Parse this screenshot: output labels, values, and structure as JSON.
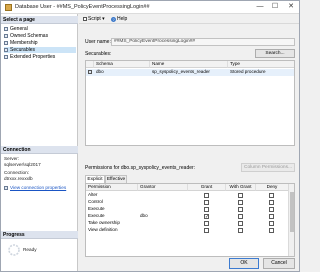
{
  "title": "Database User - ##MS_PolicyEventProcessingLogin##",
  "window_controls": [
    "—",
    "☐",
    "✕"
  ],
  "left": {
    "select_page_header": "Select a page",
    "pages": [
      "General",
      "Owned Schemas",
      "Membership",
      "Securables",
      "Extended Properties"
    ],
    "selected_page": "Securables",
    "connection_header": "Connection",
    "server_label": "Server:",
    "server_value": "sqlserver\\sql2017",
    "connection_label": "Connection:",
    "connection_value": "dtrxxx.rexxxlb",
    "view_connection_link": "View connection properties",
    "progress_header": "Progress",
    "progress_status": "Ready"
  },
  "toolbar": {
    "script": "Script",
    "help": "Help"
  },
  "user_name_label": "User name:",
  "user_name_value": "##MS_PolicyEventProcessingLogin##",
  "search_button": "Search...",
  "securables_label": "Securables:",
  "securables": {
    "headers": [
      "Schema",
      "Name",
      "Type"
    ],
    "rows": [
      {
        "schema": "dbo",
        "name": "sp_syspolicy_events_reader",
        "type": "Stored procedure"
      }
    ]
  },
  "permissions_label": "Permissions for dbo.sp_syspolicy_events_reader:",
  "column_permissions_button": "Column Permissions...",
  "tabs": [
    "Explicit",
    "Effective"
  ],
  "permissions": {
    "headers": [
      "Permission",
      "Grantor",
      "Grant",
      "With Grant",
      "Deny"
    ],
    "rows": [
      {
        "permission": "Alter",
        "grantor": "",
        "grant": false,
        "with_grant": false,
        "deny": false
      },
      {
        "permission": "Control",
        "grantor": "",
        "grant": false,
        "with_grant": false,
        "deny": false
      },
      {
        "permission": "Execute",
        "grantor": "",
        "grant": false,
        "with_grant": false,
        "deny": false
      },
      {
        "permission": "Execute",
        "grantor": "dbo",
        "grant": true,
        "with_grant": false,
        "deny": false
      },
      {
        "permission": "Take ownership",
        "grantor": "",
        "grant": false,
        "with_grant": false,
        "deny": false
      },
      {
        "permission": "View definition",
        "grantor": "",
        "grant": false,
        "with_grant": false,
        "deny": false
      }
    ]
  },
  "ok_button": "OK",
  "cancel_button": "Cancel"
}
